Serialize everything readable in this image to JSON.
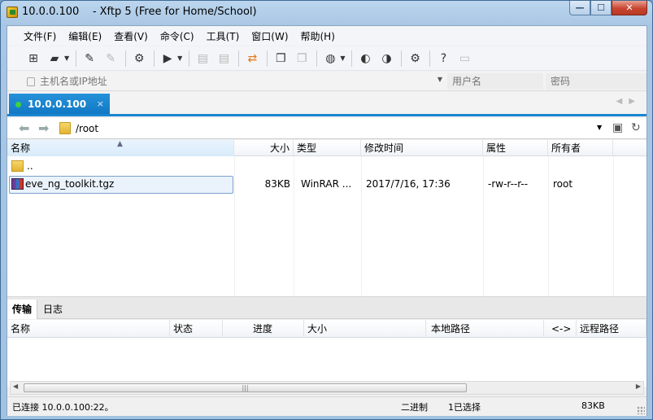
{
  "window": {
    "title": "10.0.0.100    - Xftp 5 (Free for Home/School)",
    "minimize": "—",
    "maximize": "☐",
    "close": "✕"
  },
  "menu": [
    "文件(F)",
    "编辑(E)",
    "查看(V)",
    "命令(C)",
    "工具(T)",
    "窗口(W)",
    "帮助(H)"
  ],
  "address": {
    "host_placeholder": "主机名或IP地址",
    "user_placeholder": "用户名",
    "pass_placeholder": "密码"
  },
  "tab": {
    "label": "10.0.0.100",
    "close": "×"
  },
  "path": {
    "value": "/root"
  },
  "file_columns": [
    "名称",
    "大小",
    "类型",
    "修改时间",
    "属性",
    "所有者"
  ],
  "files": [
    {
      "name": "..",
      "size": "",
      "type": "",
      "modified": "",
      "attrs": "",
      "owner": ""
    },
    {
      "name": "eve_ng_toolkit.tgz",
      "size": "83KB",
      "type": "WinRAR ...",
      "modified": "2017/7/16, 17:36",
      "attrs": "-rw-r--r--",
      "owner": "root"
    }
  ],
  "lower_tabs": [
    "传输",
    "日志"
  ],
  "transfer_columns": [
    "名称",
    "状态",
    "进度",
    "大小",
    "本地路径",
    "<->",
    "远程路径"
  ],
  "status": {
    "connection": "已连接 10.0.0.100:22。",
    "mode": "二进制",
    "selection": "1已选择",
    "size": "83KB"
  },
  "colors": {
    "accent": "#1a85d0",
    "tab_active": "#1177c4"
  }
}
